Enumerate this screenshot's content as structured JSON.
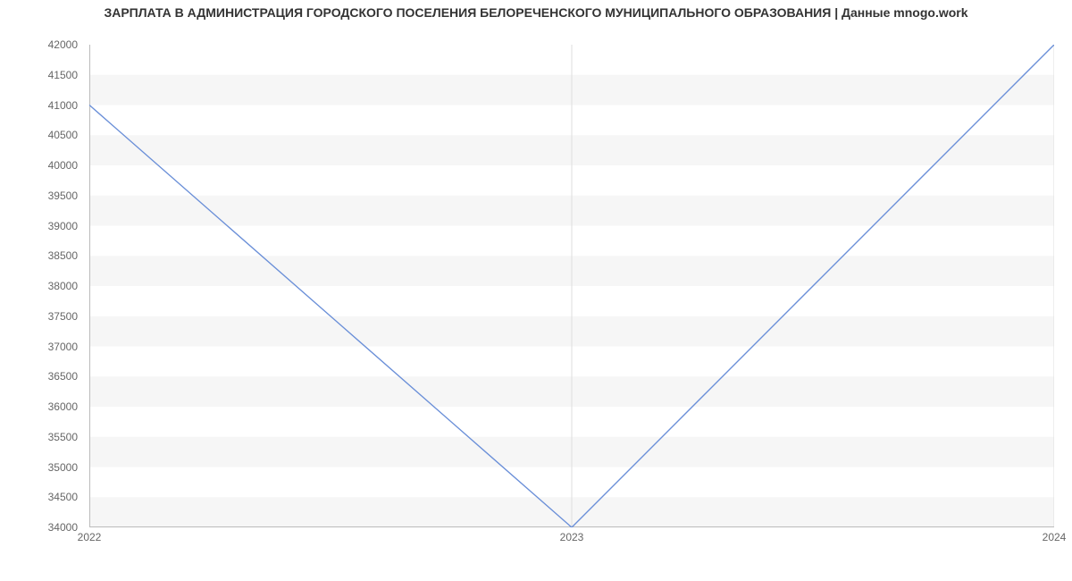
{
  "chart_data": {
    "type": "line",
    "title": "ЗАРПЛАТА В АДМИНИСТРАЦИЯ ГОРОДСКОГО ПОСЕЛЕНИЯ БЕЛОРЕЧЕНСКОГО МУНИЦИПАЛЬНОГО ОБРАЗОВАНИЯ | Данные mnogo.work",
    "xlabel": "",
    "ylabel": "",
    "x_categories": [
      "2022",
      "2023",
      "2024"
    ],
    "x": [
      2022,
      2023,
      2024
    ],
    "values": [
      41000,
      34000,
      42000
    ],
    "ylim": [
      34000,
      42000
    ],
    "y_ticks": [
      34000,
      34500,
      35000,
      35500,
      36000,
      36500,
      37000,
      37500,
      38000,
      38500,
      39000,
      39500,
      40000,
      40500,
      41000,
      41500,
      42000
    ],
    "line_color": "#6a8fd8",
    "grid_band_color": "#ececec",
    "plot_bg": "#f6f6f6"
  }
}
